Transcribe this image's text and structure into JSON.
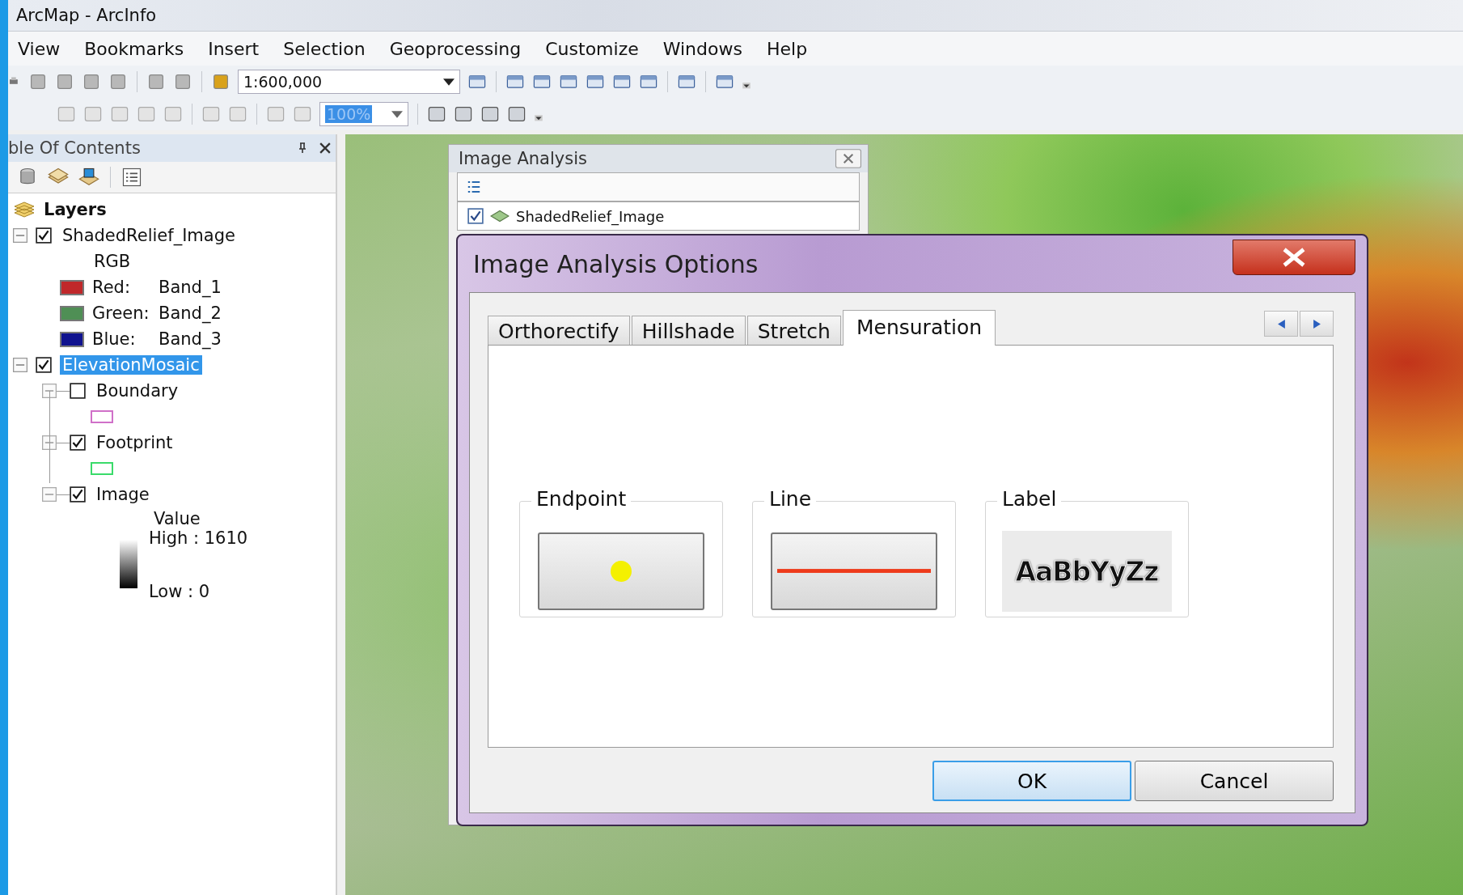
{
  "window": {
    "title": "ArcMap - ArcInfo"
  },
  "menu": [
    "View",
    "Bookmarks",
    "Insert",
    "Selection",
    "Geoprocessing",
    "Customize",
    "Windows",
    "Help"
  ],
  "toolbar": {
    "scale": "1:600,000",
    "zoom": "100%"
  },
  "toc": {
    "title": "ble Of Contents",
    "root": "Layers",
    "layers": [
      {
        "name": "ShadedRelief_Image",
        "checked": true,
        "expanded": true,
        "selected": false,
        "legend_title": "RGB",
        "legend": [
          {
            "label": "Red:",
            "band": "Band_1",
            "color": "#c0282a"
          },
          {
            "label": "Green:",
            "band": "Band_2",
            "color": "#4f8f55"
          },
          {
            "label": "Blue:",
            "band": "Band_3",
            "color": "#10138f"
          }
        ]
      },
      {
        "name": "ElevationMosaic",
        "checked": true,
        "expanded": true,
        "selected": true,
        "children": [
          {
            "kind": "polygon",
            "name": "Boundary",
            "checked": false,
            "expanded": true,
            "color": "#d070c8"
          },
          {
            "kind": "polygon",
            "name": "Footprint",
            "checked": true,
            "expanded": true,
            "color": "#3adb6a"
          },
          {
            "kind": "raster",
            "name": "Image",
            "checked": true,
            "expanded": true,
            "legend_title": "Value",
            "high": "High : 1610",
            "low": "Low : 0"
          }
        ]
      }
    ]
  },
  "image_analysis": {
    "title": "Image Analysis",
    "layers": [
      {
        "name": "ShadedRelief_Image",
        "checked": true
      }
    ]
  },
  "dialog": {
    "title": "Image Analysis Options",
    "tabs": [
      {
        "label": "Orthorectify",
        "selected": false
      },
      {
        "label": "Hillshade",
        "selected": false
      },
      {
        "label": "Stretch",
        "selected": false
      },
      {
        "label": "Mensuration",
        "selected": true
      }
    ],
    "groups": [
      {
        "kind": "endpoint",
        "title": "Endpoint"
      },
      {
        "kind": "line",
        "title": "Line"
      },
      {
        "kind": "label",
        "title": "Label",
        "sample": "AaBbYyZz"
      }
    ],
    "buttons": [
      {
        "label": "OK",
        "kind": "default"
      },
      {
        "label": "Cancel",
        "kind": "normal"
      }
    ]
  }
}
